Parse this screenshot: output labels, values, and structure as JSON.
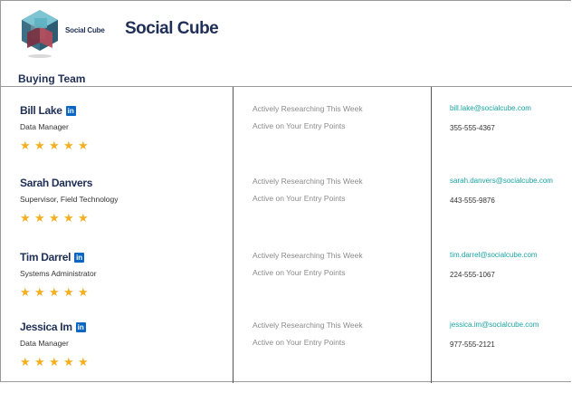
{
  "brand": {
    "logo_caption": "Social Cube",
    "company_name": "Social Cube"
  },
  "section": {
    "title": "Buying Team"
  },
  "star_glyph": "★",
  "linkedin_label": "in",
  "contacts": [
    {
      "name": "Bill Lake",
      "has_linkedin": true,
      "title": "Data Manager",
      "rating": 5,
      "activity_1": "Actively Researching This Week",
      "activity_2": "Active on Your Entry Points",
      "email": "bill.lake@socialcube.com",
      "phone": "355-555-4367"
    },
    {
      "name": "Sarah Danvers",
      "has_linkedin": false,
      "title": "Supervisor, Field Technology",
      "rating": 5,
      "activity_1": "Actively Researching This Week",
      "activity_2": "Active on Your Entry Points",
      "email": "sarah.danvers@socialcube.com",
      "phone": "443-555-9876"
    },
    {
      "name": "Tim Darrel",
      "has_linkedin": true,
      "title": "Systems Administrator",
      "rating": 5,
      "activity_1": "Actively Researching This Week",
      "activity_2": "Active on Your Entry Points",
      "email": "tim.darrel@socialcube.com",
      "phone": "224-555-1067"
    },
    {
      "name": "Jessica Im",
      "has_linkedin": true,
      "title": "Data Manager",
      "rating": 5,
      "activity_1": "Actively Researching This Week",
      "activity_2": "Active on Your Entry Points",
      "email": "jessica.im@socialcube.com",
      "phone": "977-555-2121"
    }
  ],
  "colors": {
    "brand_navy": "#1f2f56",
    "link_teal": "#1aa3a3",
    "star_gold": "#f2b01e",
    "linkedin_blue": "#0a66c2"
  }
}
